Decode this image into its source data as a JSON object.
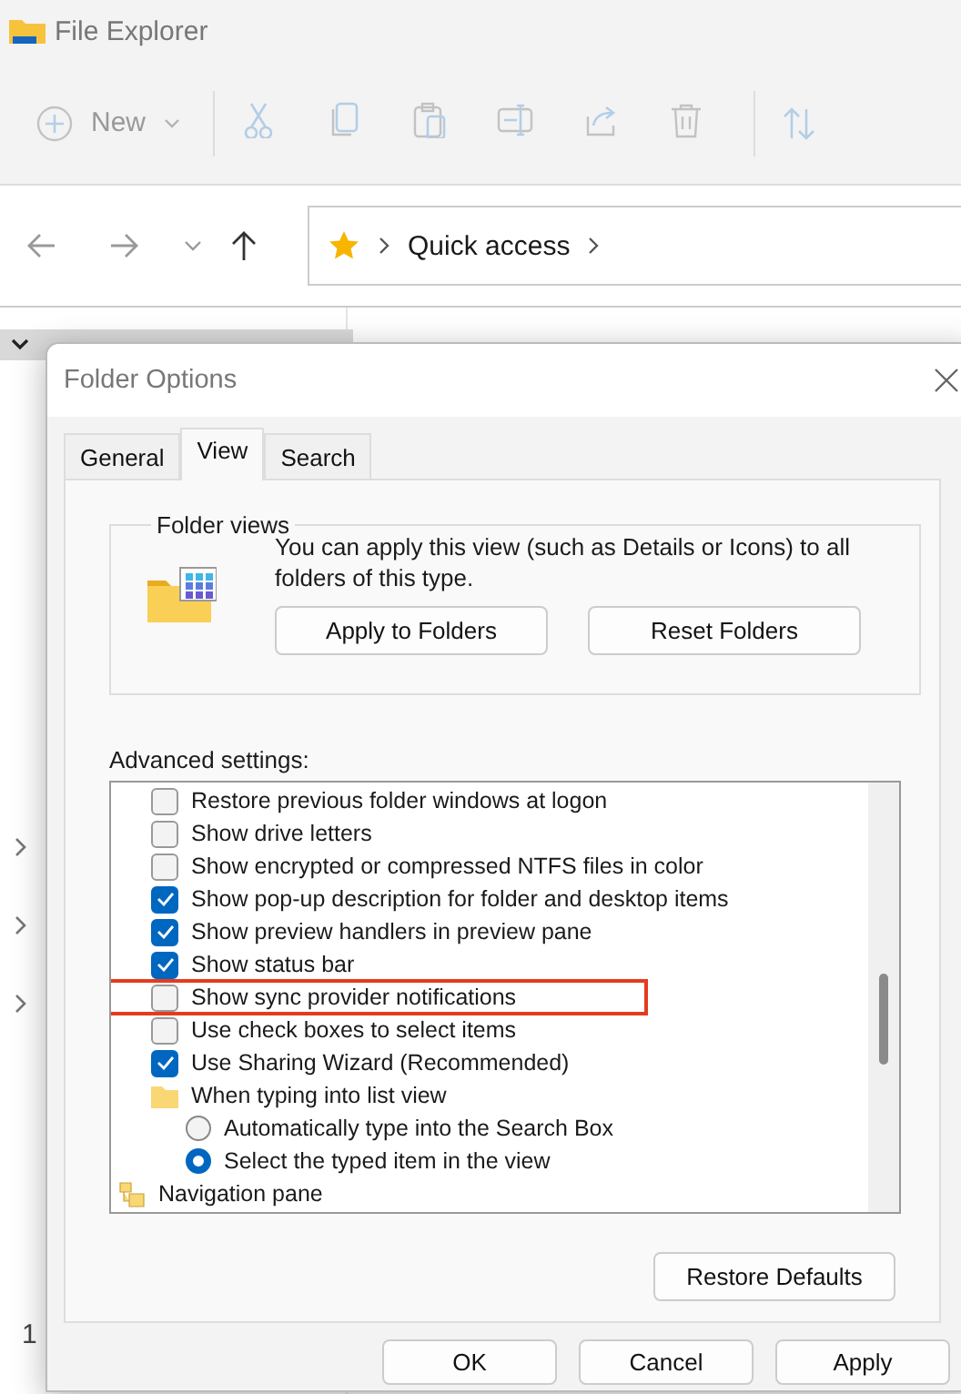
{
  "explorer": {
    "title": "File Explorer",
    "toolbar": {
      "new_label": "New",
      "commands_disabled": true
    },
    "address": {
      "crumbs": [
        "Quick access"
      ]
    },
    "status_fragment": "1"
  },
  "dialog": {
    "title": "Folder Options",
    "tabs": [
      {
        "label": "General",
        "selected": false
      },
      {
        "label": "View",
        "selected": true
      },
      {
        "label": "Search",
        "selected": false
      }
    ],
    "folder_views": {
      "legend": "Folder views",
      "text": "You can apply this view (such as Details or Icons) to all folders of this type.",
      "buttons": [
        "Apply to Folders",
        "Reset Folders"
      ]
    },
    "advanced_label": "Advanced settings:",
    "settings": [
      {
        "kind": "checkbox",
        "label": "Restore previous folder windows at logon",
        "checked": false,
        "highlighted": false
      },
      {
        "kind": "checkbox",
        "label": "Show drive letters",
        "checked": false,
        "highlighted": false
      },
      {
        "kind": "checkbox",
        "label": "Show encrypted or compressed NTFS files in color",
        "checked": false,
        "highlighted": false
      },
      {
        "kind": "checkbox",
        "label": "Show pop-up description for folder and desktop items",
        "checked": true,
        "highlighted": false
      },
      {
        "kind": "checkbox",
        "label": "Show preview handlers in preview pane",
        "checked": true,
        "highlighted": false
      },
      {
        "kind": "checkbox",
        "label": "Show status bar",
        "checked": true,
        "highlighted": false
      },
      {
        "kind": "checkbox",
        "label": "Show sync provider notifications",
        "checked": false,
        "highlighted": true
      },
      {
        "kind": "checkbox",
        "label": "Use check boxes to select items",
        "checked": false,
        "highlighted": false
      },
      {
        "kind": "checkbox",
        "label": "Use Sharing Wizard (Recommended)",
        "checked": true,
        "highlighted": false
      },
      {
        "kind": "group",
        "label": "When typing into list view",
        "children": [
          {
            "kind": "radio",
            "label": "Automatically type into the Search Box",
            "selected": false
          },
          {
            "kind": "radio",
            "label": "Select the typed item in the view",
            "selected": true
          }
        ]
      },
      {
        "kind": "category",
        "label": "Navigation pane"
      }
    ],
    "restore_button": "Restore Defaults",
    "buttons": [
      "OK",
      "Cancel",
      "Apply"
    ]
  }
}
